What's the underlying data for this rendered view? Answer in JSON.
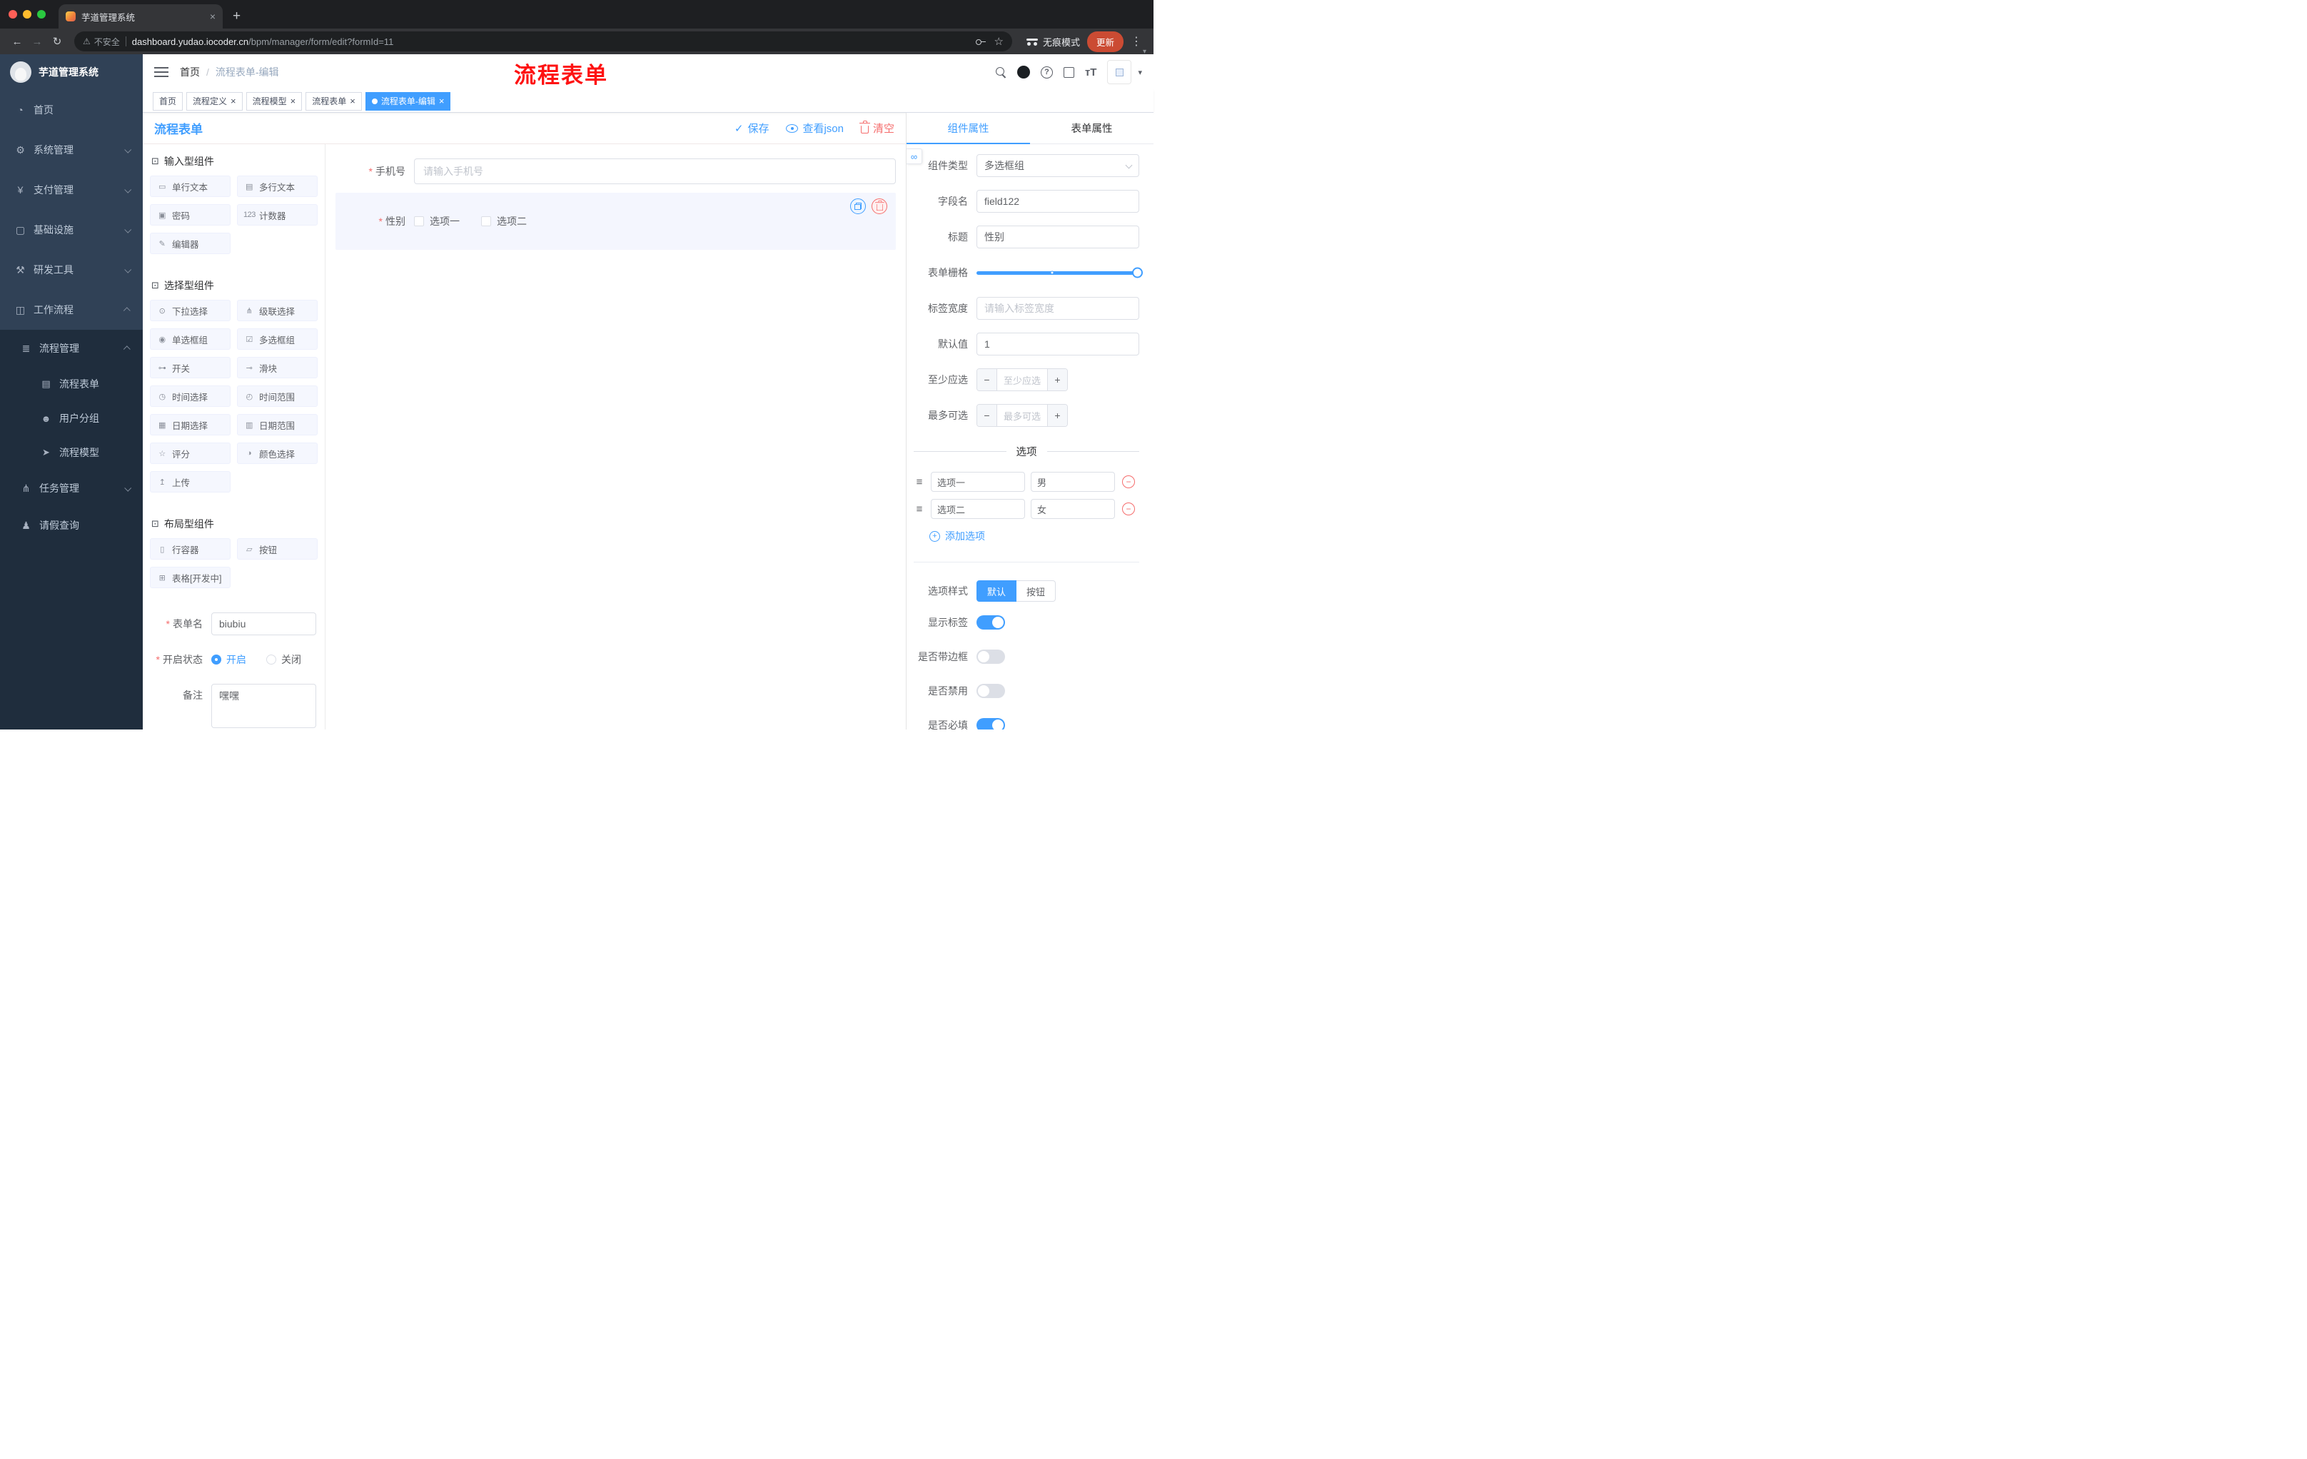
{
  "browser": {
    "tab_title": "芋道管理系统",
    "security_label": "不安全",
    "url_host": "dashboard.yudao.iocoder.cn",
    "url_path": "/bpm/manager/form/edit?formId=11",
    "incognito_label": "无痕模式",
    "update_label": "更新"
  },
  "ui_icons": {
    "back": "back-icon",
    "forward": "forward-icon",
    "reload": "reload-icon",
    "warning": "warning-icon",
    "star": "star-icon",
    "dots": "menu-dots-icon",
    "caret": "caret-down-icon",
    "plus": "plus-icon",
    "close": "close-icon",
    "save": "save-icon",
    "minus": "minus-icon",
    "drag": "drag-icon",
    "link": "link-icon",
    "section": "section-icon",
    "fontsize": "fontsize-icon"
  },
  "sidebar": {
    "title": "芋道管理系统",
    "menu": [
      {
        "label": "首页",
        "icon": "dashboard-icon",
        "arrow": "none"
      },
      {
        "label": "系统管理",
        "icon": "gear-icon",
        "arrow": "down"
      },
      {
        "label": "支付管理",
        "icon": "payment-icon",
        "arrow": "down"
      },
      {
        "label": "基础设施",
        "icon": "infra-icon",
        "arrow": "down"
      },
      {
        "label": "研发工具",
        "icon": "tools-icon",
        "arrow": "down"
      },
      {
        "label": "工作流程",
        "icon": "workflow-icon",
        "arrow": "up"
      }
    ],
    "process_group": {
      "label": "流程管理",
      "icon": "process-manage-icon",
      "arrow": "up"
    },
    "process_items": [
      {
        "label": "流程表单",
        "icon": "form-icon"
      },
      {
        "label": "用户分组",
        "icon": "user-group-icon"
      },
      {
        "label": "流程模型",
        "icon": "model-icon"
      }
    ],
    "workflow_items": [
      {
        "label": "任务管理",
        "icon": "task-icon",
        "arrow": "down"
      },
      {
        "label": "请假查询",
        "icon": "leave-icon",
        "arrow": "none"
      }
    ]
  },
  "header": {
    "breadcrumb_home": "首页",
    "breadcrumb_sep": "/",
    "breadcrumb_current": "流程表单-编辑",
    "annotation": "流程表单",
    "icons": [
      "search-icon",
      "github-icon",
      "help-icon",
      "fullscreen-icon",
      "fontsize-icon",
      "avatar",
      "caret-down-icon"
    ]
  },
  "tags": [
    {
      "label": "首页",
      "closable": false,
      "active": false
    },
    {
      "label": "流程定义",
      "closable": true,
      "active": false
    },
    {
      "label": "流程模型",
      "closable": true,
      "active": false
    },
    {
      "label": "流程表单",
      "closable": true,
      "active": false
    },
    {
      "label": "流程表单-编辑",
      "closable": true,
      "active": true
    }
  ],
  "designer": {
    "panel_title": "流程表单",
    "actions": {
      "save": "保存",
      "view_json": "查看json",
      "clear": "清空"
    },
    "palette": {
      "sections": [
        {
          "title": "输入型组件",
          "items": [
            {
              "label": "单行文本",
              "icon": "input-icon"
            },
            {
              "label": "多行文本",
              "icon": "textarea-icon"
            },
            {
              "label": "密码",
              "icon": "password-icon"
            },
            {
              "label": "计数器",
              "icon": "counter-icon"
            },
            {
              "label": "编辑器",
              "icon": "editor-icon"
            }
          ]
        },
        {
          "title": "选择型组件",
          "items": [
            {
              "label": "下拉选择",
              "icon": "select-icon"
            },
            {
              "label": "级联选择",
              "icon": "cascader-icon"
            },
            {
              "label": "单选框组",
              "icon": "radio-icon"
            },
            {
              "label": "多选框组",
              "icon": "checkbox-icon"
            },
            {
              "label": "开关",
              "icon": "switch-icon"
            },
            {
              "label": "滑块",
              "icon": "slider-icon"
            },
            {
              "label": "时间选择",
              "icon": "time-icon"
            },
            {
              "label": "时间范围",
              "icon": "time-range-icon"
            },
            {
              "label": "日期选择",
              "icon": "date-icon"
            },
            {
              "label": "日期范围",
              "icon": "date-range-icon"
            },
            {
              "label": "评分",
              "icon": "rate-icon"
            },
            {
              "label": "颜色选择",
              "icon": "color-icon"
            },
            {
              "label": "上传",
              "icon": "upload-icon"
            }
          ]
        },
        {
          "title": "布局型组件",
          "items": [
            {
              "label": "行容器",
              "icon": "row-icon"
            },
            {
              "label": "按钮",
              "icon": "button-icon"
            },
            {
              "label": "表格[开发中]",
              "icon": "table-icon"
            }
          ]
        }
      ]
    },
    "meta": {
      "name_label": "表单名",
      "name_value": "biubiu",
      "status_label": "开启状态",
      "status_on": "开启",
      "status_off": "关闭",
      "remark_label": "备注",
      "remark_value": "嘿嘿"
    },
    "canvas": {
      "phone_label": "手机号",
      "phone_placeholder": "请输入手机号",
      "gender_label": "性别",
      "gender_options": [
        "选项一",
        "选项二"
      ]
    }
  },
  "props": {
    "tabs": {
      "component": "组件属性",
      "form": "表单属性"
    },
    "rows": {
      "component_type": {
        "label": "组件类型",
        "value": "多选框组"
      },
      "field_name": {
        "label": "字段名",
        "value": "field122"
      },
      "title": {
        "label": "标题",
        "value": "性别"
      },
      "grid": {
        "label": "表单栅格"
      },
      "label_width": {
        "label": "标签宽度",
        "placeholder": "请输入标签宽度"
      },
      "default_value": {
        "label": "默认值",
        "value": "1"
      },
      "min_select": {
        "label": "至少应选",
        "placeholder": "至少应选"
      },
      "max_select": {
        "label": "最多可选",
        "placeholder": "最多可选"
      }
    },
    "options": {
      "divider": "选项",
      "rows": [
        {
          "name": "选项一",
          "value": "男"
        },
        {
          "name": "选项二",
          "value": "女"
        }
      ],
      "add_label": "添加选项"
    },
    "style": {
      "label": "选项样式",
      "options": [
        "默认",
        "按钮"
      ],
      "active": "默认"
    },
    "switches": {
      "show_label": {
        "label": "显示标签",
        "on": true
      },
      "with_border": {
        "label": "是否带边框",
        "on": false
      },
      "disabled": {
        "label": "是否禁用",
        "on": false
      },
      "required": {
        "label": "是否必填",
        "on": true
      }
    }
  },
  "colors": {
    "accent": "#409eff",
    "danger": "#f56c6c",
    "annotation_red": "#fe1212",
    "sidebar_bg": "#304156",
    "submenu_bg": "#1f2d3d",
    "active_tag": "#409eff",
    "update_badge": "#cb4b33"
  }
}
